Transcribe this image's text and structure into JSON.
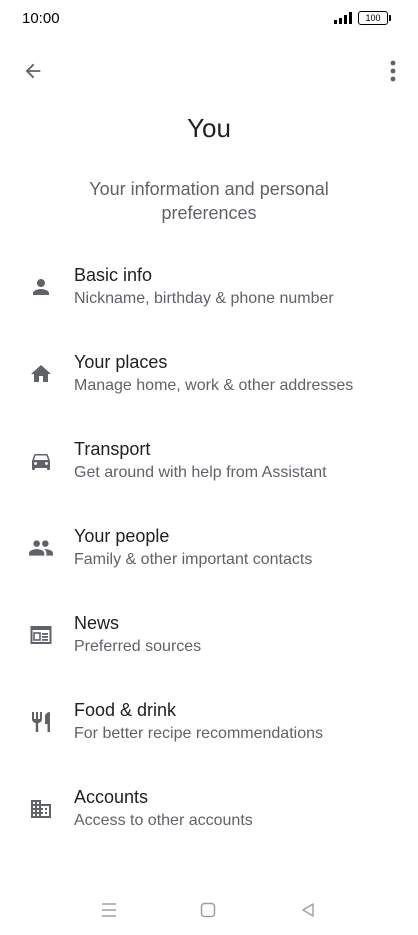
{
  "status_bar": {
    "time": "10:00",
    "battery": "100",
    "icons": [
      "signal-icon",
      "battery-icon"
    ]
  },
  "toolbar": {
    "back_icon": "arrow-back-icon",
    "more_icon": "more-vert-icon"
  },
  "page": {
    "title": "You",
    "subtitle": "Your information and personal preferences"
  },
  "menu": {
    "items": [
      {
        "title": "Basic info",
        "subtitle": "Nickname, birthday & phone number",
        "icon": "person-icon"
      },
      {
        "title": "Your places",
        "subtitle": "Manage home, work & other addresses",
        "icon": "home-icon"
      },
      {
        "title": "Transport",
        "subtitle": "Get around with help from Assistant",
        "icon": "car-icon"
      },
      {
        "title": "Your people",
        "subtitle": "Family & other important contacts",
        "icon": "people-icon"
      },
      {
        "title": "News",
        "subtitle": "Preferred sources",
        "icon": "news-icon"
      },
      {
        "title": "Food & drink",
        "subtitle": "For better recipe recommendations",
        "icon": "restaurant-icon"
      },
      {
        "title": "Accounts",
        "subtitle": "Access to other accounts",
        "icon": "business-icon"
      }
    ]
  },
  "nav_bar": {
    "icons": [
      "menu-icon",
      "home-square-icon",
      "back-triangle-icon"
    ]
  },
  "colors": {
    "primary_text": "#202124",
    "secondary_text": "#5f6368",
    "icon": "#5f6368",
    "background": "#ffffff"
  }
}
